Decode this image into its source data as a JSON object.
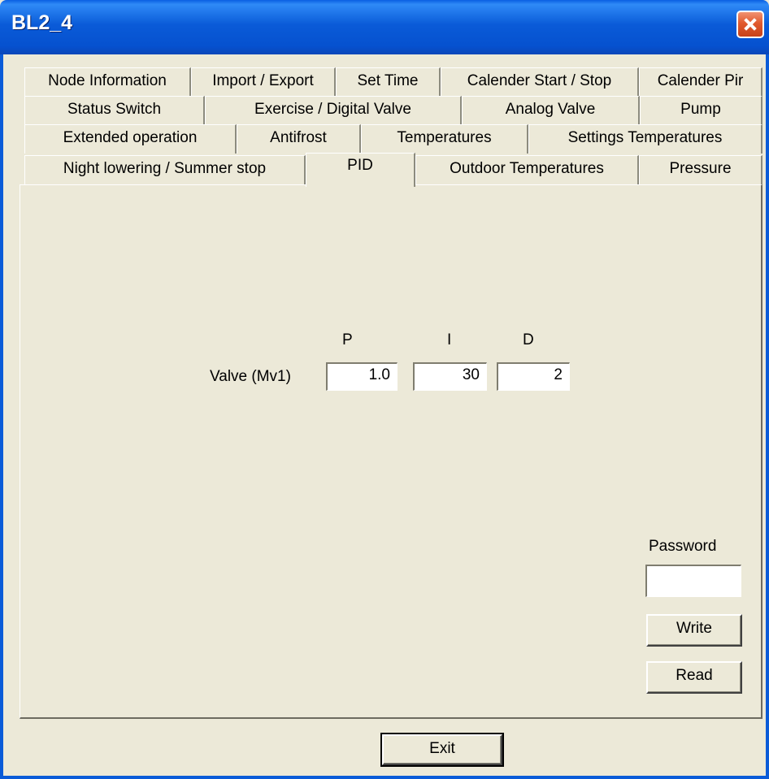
{
  "window": {
    "title": "BL2_4"
  },
  "tabs": {
    "row1": [
      "Node Information",
      "Import / Export",
      "Set Time",
      "Calender Start / Stop",
      "Calender Pir"
    ],
    "row2": [
      "Status Switch",
      "Exercise / Digital Valve",
      "Analog Valve",
      "Pump"
    ],
    "row3": [
      "Extended operation",
      "Antifrost",
      "Temperatures",
      "Settings Temperatures"
    ],
    "row4": [
      "Night lowering / Summer stop",
      "PID",
      "Outdoor Temperatures",
      "Pressure"
    ],
    "active": "PID"
  },
  "pid": {
    "col_p": "P",
    "col_i": "I",
    "col_d": "D",
    "row_label": "Valve (Mv1)",
    "p_value": "1.0",
    "i_value": "30",
    "d_value": "2"
  },
  "auth": {
    "password_label": "Password",
    "password_value": "",
    "write_label": "Write",
    "read_label": "Read"
  },
  "footer": {
    "exit_label": "Exit"
  }
}
